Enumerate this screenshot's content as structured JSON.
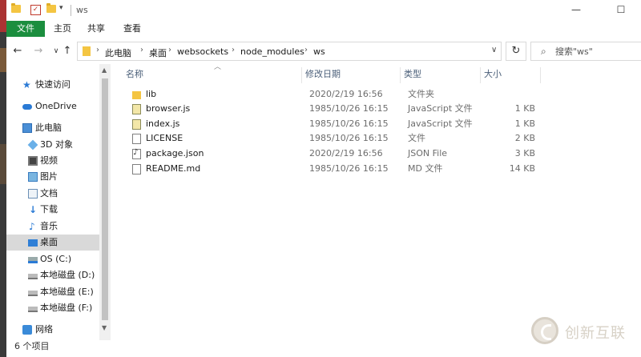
{
  "window": {
    "title": "ws",
    "controls": {
      "minimize": "—",
      "maximize": "☐"
    }
  },
  "ribbon": {
    "tabs": [
      "文件",
      "主页",
      "共享",
      "查看"
    ]
  },
  "address": {
    "breadcrumbs": [
      "此电脑",
      "桌面",
      "websockets",
      "node_modules",
      "ws"
    ],
    "search_placeholder": "搜索\"ws\""
  },
  "nav": {
    "items": [
      {
        "label": "快速访问",
        "icon": "star-icon"
      },
      {
        "label": "OneDrive",
        "icon": "cloud-icon"
      },
      {
        "label": "此电脑",
        "icon": "computer-icon"
      },
      {
        "label": "3D 对象",
        "icon": "3d-objects-icon"
      },
      {
        "label": "视频",
        "icon": "video-icon"
      },
      {
        "label": "图片",
        "icon": "pictures-icon"
      },
      {
        "label": "文档",
        "icon": "documents-icon"
      },
      {
        "label": "下载",
        "icon": "download-icon"
      },
      {
        "label": "音乐",
        "icon": "music-icon"
      },
      {
        "label": "桌面",
        "icon": "desktop-icon",
        "selected": true
      },
      {
        "label": "OS (C:)",
        "icon": "os-drive-icon"
      },
      {
        "label": "本地磁盘 (D:)",
        "icon": "drive-icon"
      },
      {
        "label": "本地磁盘 (E:)",
        "icon": "drive-icon"
      },
      {
        "label": "本地磁盘 (F:)",
        "icon": "drive-icon"
      },
      {
        "label": "网络",
        "icon": "network-icon"
      }
    ]
  },
  "list": {
    "columns": [
      "名称",
      "修改日期",
      "类型",
      "大小"
    ],
    "files": [
      {
        "name": "lib",
        "modified": "2020/2/19 16:56",
        "type": "文件夹",
        "size": "",
        "icon": "folder-icon"
      },
      {
        "name": "browser.js",
        "modified": "1985/10/26 16:15",
        "type": "JavaScript 文件",
        "size": "1 KB",
        "icon": "js-file-icon"
      },
      {
        "name": "index.js",
        "modified": "1985/10/26 16:15",
        "type": "JavaScript 文件",
        "size": "1 KB",
        "icon": "js-file-icon"
      },
      {
        "name": "LICENSE",
        "modified": "1985/10/26 16:15",
        "type": "文件",
        "size": "2 KB",
        "icon": "file-icon"
      },
      {
        "name": "package.json",
        "modified": "2020/2/19 16:56",
        "type": "JSON File",
        "size": "3 KB",
        "icon": "json-file-icon"
      },
      {
        "name": "README.md",
        "modified": "1985/10/26 16:15",
        "type": "MD 文件",
        "size": "14 KB",
        "icon": "file-icon"
      }
    ]
  },
  "status": {
    "item_count": "6 个项目"
  },
  "watermark": {
    "text": "创新互联"
  }
}
